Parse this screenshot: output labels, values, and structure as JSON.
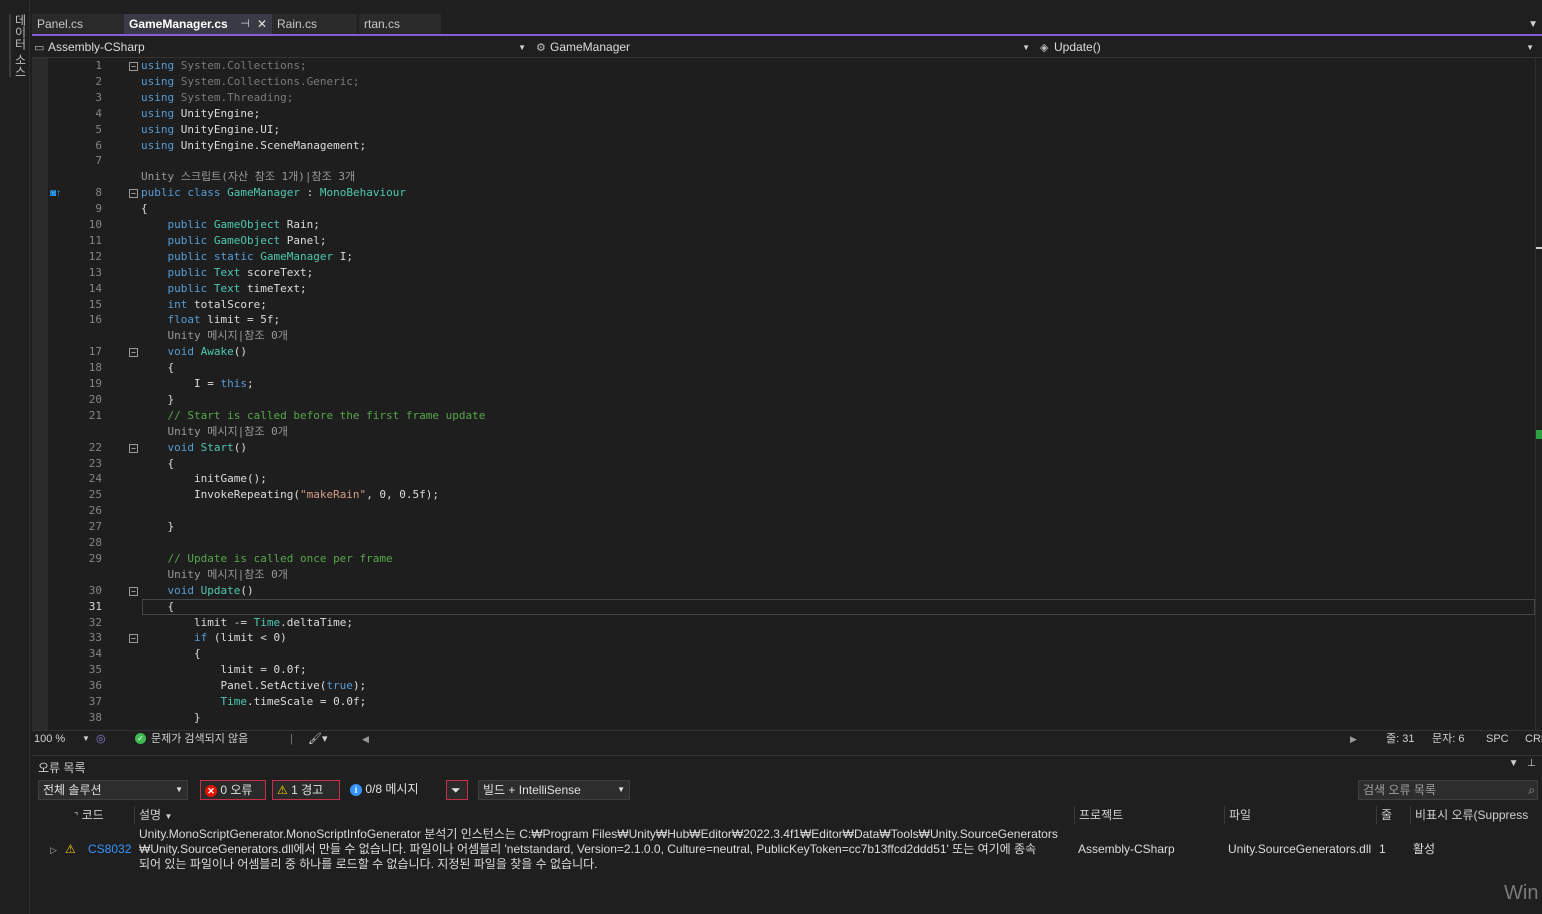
{
  "side_tab": "데이터 소스",
  "tabs": [
    {
      "label": "Panel.cs"
    },
    {
      "label": "GameManager.cs"
    },
    {
      "label": "Rain.cs"
    },
    {
      "label": "rtan.cs"
    }
  ],
  "tab_pin_glyph": "⊣",
  "tab_close_glyph": "✕",
  "nav": {
    "project": "Assembly-CSharp",
    "type": "GameManager",
    "member": "Update()"
  },
  "code": [
    {
      "n": "1",
      "parts": [
        {
          "t": "using",
          "c": "kw"
        },
        {
          "t": " System.Collections;",
          "c": "dim"
        }
      ]
    },
    {
      "n": "2",
      "parts": [
        {
          "t": "using",
          "c": "kw"
        },
        {
          "t": " System.Collections.Generic;",
          "c": "dim"
        }
      ]
    },
    {
      "n": "3",
      "parts": [
        {
          "t": "using",
          "c": "kw"
        },
        {
          "t": " System.Threading;",
          "c": "dim"
        }
      ]
    },
    {
      "n": "4",
      "parts": [
        {
          "t": "using",
          "c": "kw"
        },
        {
          "t": " UnityEngine;",
          "c": ""
        }
      ]
    },
    {
      "n": "5",
      "parts": [
        {
          "t": "using",
          "c": "kw"
        },
        {
          "t": " UnityEngine.UI;",
          "c": ""
        }
      ]
    },
    {
      "n": "6",
      "parts": [
        {
          "t": "using",
          "c": "kw"
        },
        {
          "t": " UnityEngine.SceneManagement;",
          "c": ""
        }
      ]
    },
    {
      "n": "7",
      "parts": []
    },
    {
      "lens": "Unity 스크립트(자산 참조 1개)|참조 3개"
    },
    {
      "n": "8",
      "parts": [
        {
          "t": "public",
          "c": "kw"
        },
        {
          "t": " "
        },
        {
          "t": "class",
          "c": "kw"
        },
        {
          "t": " "
        },
        {
          "t": "GameManager",
          "c": "ty"
        },
        {
          "t": " : "
        },
        {
          "t": "MonoBehaviour",
          "c": "ty"
        }
      ]
    },
    {
      "n": "9",
      "parts": [
        {
          "t": "{"
        }
      ]
    },
    {
      "n": "10",
      "parts": [
        {
          "t": "    "
        },
        {
          "t": "public",
          "c": "kw"
        },
        {
          "t": " "
        },
        {
          "t": "GameObject",
          "c": "ty"
        },
        {
          "t": " Rain;"
        }
      ]
    },
    {
      "n": "11",
      "parts": [
        {
          "t": "    "
        },
        {
          "t": "public",
          "c": "kw"
        },
        {
          "t": " "
        },
        {
          "t": "GameObject",
          "c": "ty"
        },
        {
          "t": " Panel;"
        }
      ]
    },
    {
      "n": "12",
      "parts": [
        {
          "t": "    "
        },
        {
          "t": "public",
          "c": "kw"
        },
        {
          "t": " "
        },
        {
          "t": "static",
          "c": "kw"
        },
        {
          "t": " "
        },
        {
          "t": "GameManager",
          "c": "ty"
        },
        {
          "t": " I;"
        }
      ]
    },
    {
      "n": "13",
      "parts": [
        {
          "t": "    "
        },
        {
          "t": "public",
          "c": "kw"
        },
        {
          "t": " "
        },
        {
          "t": "Text",
          "c": "ty"
        },
        {
          "t": " scoreText;"
        }
      ]
    },
    {
      "n": "14",
      "parts": [
        {
          "t": "    "
        },
        {
          "t": "public",
          "c": "kw"
        },
        {
          "t": " "
        },
        {
          "t": "Text",
          "c": "ty"
        },
        {
          "t": " timeText;"
        }
      ]
    },
    {
      "n": "15",
      "parts": [
        {
          "t": "    "
        },
        {
          "t": "int",
          "c": "kw"
        },
        {
          "t": " totalScore;"
        }
      ]
    },
    {
      "n": "16",
      "parts": [
        {
          "t": "    "
        },
        {
          "t": "float",
          "c": "kw"
        },
        {
          "t": " limit = 5f;"
        }
      ]
    },
    {
      "lens": "    Unity 메시지|참조 0개"
    },
    {
      "n": "17",
      "parts": [
        {
          "t": "    "
        },
        {
          "t": "void",
          "c": "kw"
        },
        {
          "t": " "
        },
        {
          "t": "Awake",
          "c": "ty"
        },
        {
          "t": "()"
        }
      ]
    },
    {
      "n": "18",
      "parts": [
        {
          "t": "    {"
        }
      ]
    },
    {
      "n": "19",
      "parts": [
        {
          "t": "        I = "
        },
        {
          "t": "this",
          "c": "kw"
        },
        {
          "t": ";"
        }
      ]
    },
    {
      "n": "20",
      "parts": [
        {
          "t": "    }"
        }
      ]
    },
    {
      "n": "21",
      "parts": [
        {
          "t": "    "
        },
        {
          "t": "// Start is called before the first frame update",
          "c": "cm"
        }
      ]
    },
    {
      "lens": "    Unity 메시지|참조 0개"
    },
    {
      "n": "22",
      "parts": [
        {
          "t": "    "
        },
        {
          "t": "void",
          "c": "kw"
        },
        {
          "t": " "
        },
        {
          "t": "Start",
          "c": "ty"
        },
        {
          "t": "()"
        }
      ]
    },
    {
      "n": "23",
      "parts": [
        {
          "t": "    {"
        }
      ]
    },
    {
      "n": "24",
      "parts": [
        {
          "t": "        initGame();"
        }
      ]
    },
    {
      "n": "25",
      "parts": [
        {
          "t": "        InvokeRepeating("
        },
        {
          "t": "\"makeRain\"",
          "c": "st"
        },
        {
          "t": ", 0, 0.5f);"
        }
      ]
    },
    {
      "n": "26",
      "parts": []
    },
    {
      "n": "27",
      "parts": [
        {
          "t": "    }"
        }
      ]
    },
    {
      "n": "28",
      "parts": []
    },
    {
      "n": "29",
      "parts": [
        {
          "t": "    "
        },
        {
          "t": "// Update is called once per frame",
          "c": "cm"
        }
      ]
    },
    {
      "lens": "    Unity 메시지|참조 0개"
    },
    {
      "n": "30",
      "parts": [
        {
          "t": "    "
        },
        {
          "t": "void",
          "c": "kw"
        },
        {
          "t": " "
        },
        {
          "t": "Update",
          "c": "ty"
        },
        {
          "t": "()"
        }
      ]
    },
    {
      "n": "31",
      "parts": [
        {
          "t": "    {"
        }
      ]
    },
    {
      "n": "32",
      "parts": [
        {
          "t": "        limit -= "
        },
        {
          "t": "Time",
          "c": "ty"
        },
        {
          "t": ".deltaTime;"
        }
      ]
    },
    {
      "n": "33",
      "parts": [
        {
          "t": "        "
        },
        {
          "t": "if",
          "c": "kw"
        },
        {
          "t": " (limit < 0)"
        }
      ]
    },
    {
      "n": "34",
      "parts": [
        {
          "t": "        {"
        }
      ]
    },
    {
      "n": "35",
      "parts": [
        {
          "t": "            limit = 0.0f;"
        }
      ]
    },
    {
      "n": "36",
      "parts": [
        {
          "t": "            Panel.SetActive("
        },
        {
          "t": "true",
          "c": "kw"
        },
        {
          "t": ");"
        }
      ]
    },
    {
      "n": "37",
      "parts": [
        {
          "t": "            "
        },
        {
          "t": "Time",
          "c": "ty"
        },
        {
          "t": ".timeScale = 0.0f;"
        }
      ]
    },
    {
      "n": "38",
      "parts": [
        {
          "t": "        }"
        }
      ]
    }
  ],
  "fold_lines": [
    "1",
    "8",
    "17",
    "22",
    "30",
    "33"
  ],
  "current_line": "31",
  "status": {
    "zoom": "100 %",
    "issues": "문제가 검색되지 않음",
    "line": "줄: 31",
    "char": "문자: 6",
    "spc": "SPC",
    "crlf": "CRL"
  },
  "error_list": {
    "title": "오류 목록",
    "scope": "전체 솔루션",
    "errors": "0 오류",
    "warnings": "1 경고",
    "messages": "0/8 메시지",
    "build_filter": "빌드 + IntelliSense",
    "search_placeholder": "검색 오류 목록",
    "columns": {
      "code": "코드",
      "desc": "설명",
      "project": "프로젝트",
      "file": "파일",
      "line": "줄",
      "suppress": "비표시 오류(Suppress"
    },
    "rows": [
      {
        "code": "CS8032",
        "desc1": "Unity.MonoScriptGenerator.MonoScriptInfoGenerator 분석기 인스턴스는 C:₩Program Files₩Unity₩Hub₩Editor₩2022.3.4f1₩Editor₩Data₩Tools₩Unity.SourceGenerators",
        "desc2": "₩Unity.SourceGenerators.dll에서 만들 수 없습니다. 파일이나 어셈블리 'netstandard, Version=2.1.0.0, Culture=neutral, PublicKeyToken=cc7b13ffcd2ddd51' 또는 여기에 종속",
        "desc3": "되어 있는 파일이나 어셈블리 중 하나를 로드할 수 없습니다. 지정된 파일을 찾을 수 없습니다.",
        "project": "Assembly-CSharp",
        "file": "Unity.SourceGenerators.dll",
        "line": "1",
        "suppress": "활성"
      }
    ]
  },
  "watermark": "Win"
}
